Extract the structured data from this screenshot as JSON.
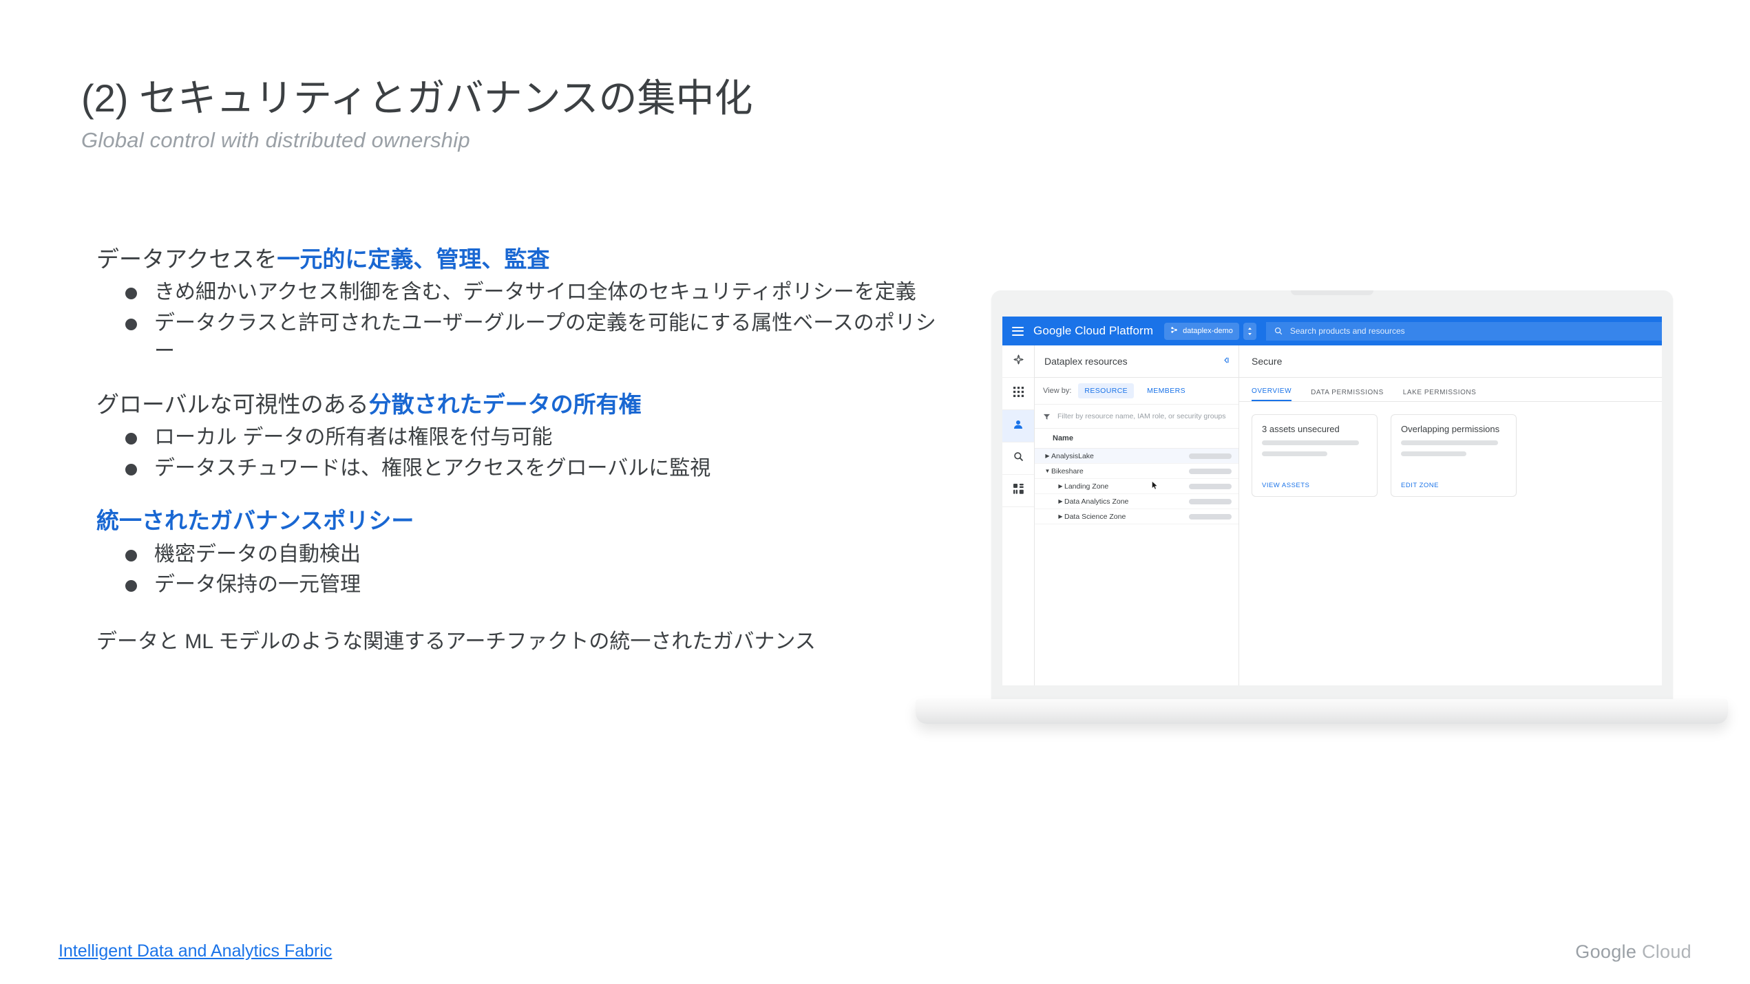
{
  "slide": {
    "title": "(2) セキュリティとガバナンスの集中化",
    "subtitle": "Global control with distributed ownership"
  },
  "body": {
    "section1": {
      "lead_plain": "データアクセスを",
      "lead_accent": "一元的に定義、管理、監査",
      "bullets": [
        "きめ細かいアクセス制御を含む、データサイロ全体のセキュリティポリシーを定義",
        "データクラスと許可されたユーザーグループの定義を可能にする属性ベースのポリシー"
      ]
    },
    "section2": {
      "lead_plain": "グローバルな可視性のある",
      "lead_accent": "分散されたデータの所有権",
      "bullets": [
        "ローカル データの所有者は権限を付与可能",
        "データスチュワードは、権限とアクセスをグローバルに監視"
      ]
    },
    "section3": {
      "lead_accent": "統一されたガバナンスポリシー",
      "bullets": [
        "機密データの自動検出",
        "データ保持の一元管理"
      ]
    },
    "closing": "データと ML モデルのような関連するアーチファクトの統一されたガバナンス"
  },
  "console": {
    "topbar": {
      "brand": "Google Cloud Platform",
      "project": "dataplex-demo",
      "search_placeholder": "Search products and resources"
    },
    "rail": [
      {
        "icon": "dataplex-logo-icon",
        "active": false
      },
      {
        "icon": "grid-apps-icon",
        "active": false
      },
      {
        "icon": "person-icon",
        "active": true
      },
      {
        "icon": "search-icon",
        "active": false
      },
      {
        "icon": "dashboard-icon",
        "active": false
      }
    ],
    "resources_panel": {
      "title": "Dataplex resources",
      "view_by_label": "View by:",
      "view_by_tabs": [
        "RESOURCE",
        "MEMBERS"
      ],
      "view_by_selected": "RESOURCE",
      "filter_placeholder": "Filter by resource name, IAM role, or security groups",
      "column_header": "Name",
      "rows": [
        {
          "name": "AnalysisLake",
          "level": 0,
          "expanded": false,
          "selected": true
        },
        {
          "name": "Bikeshare",
          "level": 0,
          "expanded": true,
          "selected": false
        },
        {
          "name": "Landing Zone",
          "level": 1,
          "expanded": false,
          "selected": false
        },
        {
          "name": "Data Analytics Zone",
          "level": 1,
          "expanded": false,
          "selected": false
        },
        {
          "name": "Data Science Zone",
          "level": 1,
          "expanded": false,
          "selected": false
        }
      ]
    },
    "detail_panel": {
      "title": "Secure",
      "tabs": [
        "OVERVIEW",
        "DATA PERMISSIONS",
        "LAKE PERMISSIONS"
      ],
      "active_tab": "OVERVIEW",
      "cards": [
        {
          "title": "3 assets unsecured",
          "action": "VIEW ASSETS"
        },
        {
          "title": "Overlapping permissions",
          "action": "EDIT ZONE"
        }
      ]
    }
  },
  "footer": {
    "link": "Intelligent Data and Analytics Fabric",
    "logo_primary": "Google",
    "logo_secondary": "Cloud"
  },
  "colors": {
    "accent_blue": "#1967d2",
    "gcp_blue": "#1a73e8",
    "text": "#3c4043",
    "muted": "#9aa0a6"
  }
}
